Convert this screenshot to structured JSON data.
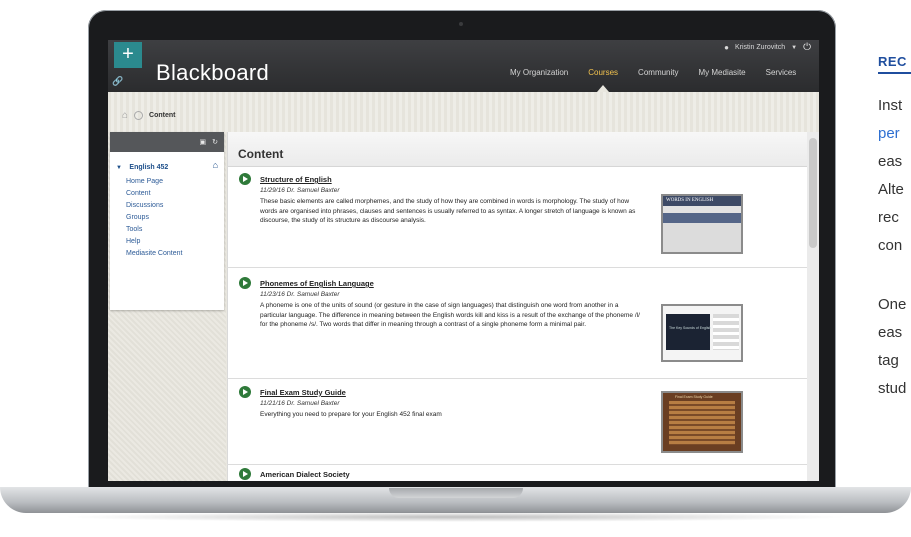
{
  "header": {
    "brand": "Blackboard",
    "user_name": "Kristin Zurovitch",
    "nav": [
      "My Organization",
      "Courses",
      "Community",
      "My Mediasite",
      "Services"
    ],
    "active_nav": "Courses"
  },
  "breadcrumb": {
    "current": "Content"
  },
  "sidebar": {
    "course": "English 452",
    "items": [
      "Home Page",
      "Content",
      "Discussions",
      "Groups",
      "Tools",
      "Help",
      "Mediasite Content"
    ]
  },
  "content": {
    "title": "Content",
    "items": [
      {
        "title": "Structure of English",
        "meta": "11/29/16  Dr. Samuel Baxter",
        "description": "These basic elements are called morphemes, and the study of how they are combined in words is morphology. The study of how words are organised into phrases, clauses and sentences is usually referred to as syntax. A longer stretch of language is known as discourse, the study of its structure as discourse analysis.",
        "thumbnail_caption": "WORDS IN ENGLISH"
      },
      {
        "title": "Phonemes of English Language",
        "meta": "11/23/16  Dr. Samuel Baxter",
        "description": "A phoneme is one of the units of sound (or gesture in the case of sign languages) that distinguish one word from another in a particular language. The difference in meaning between the English words kill and kiss is a result of the exchange of the phoneme /l/ for the phoneme /s/. Two words that differ in meaning through a contrast of a single phoneme form a minimal pair.",
        "thumbnail_caption": "The Key Sounds of English"
      },
      {
        "title": "Final Exam Study Guide",
        "meta": "11/21/16  Dr. Samuel Baxter",
        "description": "Everything you need to prepare for your English 452 final exam",
        "thumbnail_caption": "Final Exam Study Guide"
      },
      {
        "title": "American Dialect Society"
      }
    ]
  },
  "marketing": {
    "heading": "REC",
    "lines": [
      "Inst",
      "per",
      "eas",
      "Alte",
      "rec",
      "con"
    ],
    "lines2": [
      "One",
      "eas",
      "tag",
      "stud"
    ]
  },
  "colors": {
    "brand_teal": "#2b8a8e",
    "active_nav": "#f2c24e",
    "link_blue": "#1d4f8a",
    "play_green": "#2f7a3a",
    "heading_blue": "#1f4e9e"
  }
}
